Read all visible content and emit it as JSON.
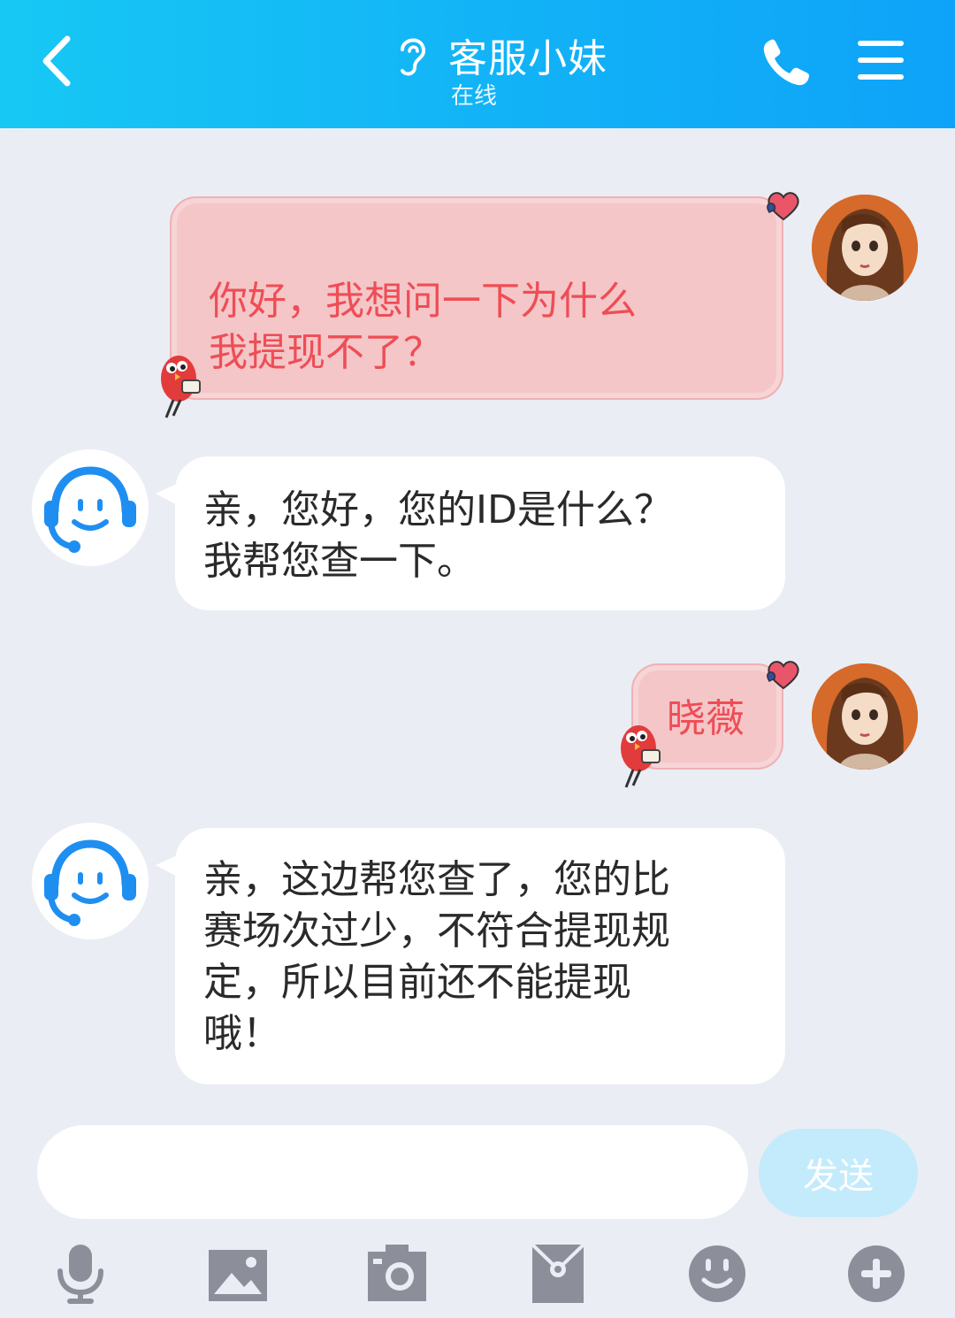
{
  "header": {
    "title": "客服小妹",
    "status": "在线",
    "back_icon": "chevron-left-icon",
    "ear_icon": "ear-icon",
    "phone_icon": "phone-icon",
    "menu_icon": "menu-icon"
  },
  "messages": [
    {
      "sender": "user",
      "text": "你好，我想问一下为什么\n我提现不了？"
    },
    {
      "sender": "service",
      "text": "亲，您好，您的ID是什么？\n我帮您查一下。"
    },
    {
      "sender": "user",
      "text": "晓薇"
    },
    {
      "sender": "service",
      "text": "亲，这边帮您查了，您的比\n赛场次过少，不符合提现规\n定，所以目前还不能提现\n哦！"
    }
  ],
  "input": {
    "value": "",
    "send_label": "发送"
  },
  "toolbar": [
    {
      "icon": "microphone-icon"
    },
    {
      "icon": "image-icon"
    },
    {
      "icon": "camera-icon"
    },
    {
      "icon": "red-packet-icon"
    },
    {
      "icon": "emoji-icon"
    },
    {
      "icon": "plus-icon"
    }
  ],
  "colors": {
    "header_start": "#17c8f4",
    "header_end": "#0ea3f9",
    "chat_bg": "#eaedf4",
    "user_bubble": "#f4c6c8",
    "user_text": "#ef4d55",
    "service_icon": "#1f8ef1",
    "toolbar_icon": "#8c8f9a",
    "send_button": "#c3ebfc"
  }
}
